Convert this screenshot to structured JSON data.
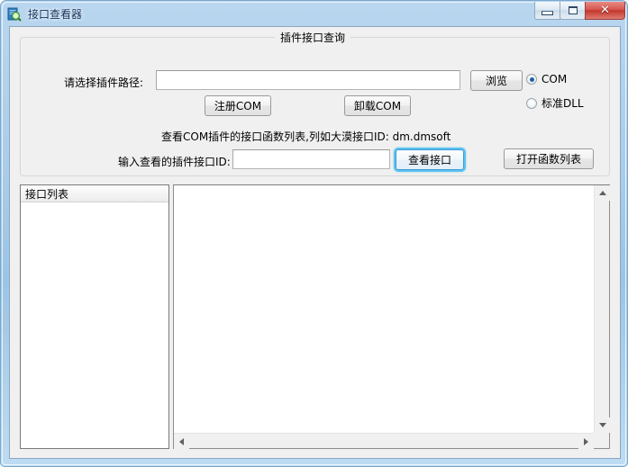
{
  "window": {
    "title": "接口查看器",
    "icon": "document-magnifier-icon",
    "controls": {
      "minimize": "minimize-icon",
      "maximize": "maximize-icon",
      "close": "✕"
    }
  },
  "group": {
    "title": "插件接口查询"
  },
  "form": {
    "path_label": "请选择插件路径:",
    "path_value": "",
    "path_placeholder": "",
    "browse_button": "浏览",
    "register_button": "注册COM",
    "unregister_button": "卸载COM",
    "hint_text": "查看COM插件的接口函数列表,列如大漠接口ID: dm.dmsoft",
    "id_label": "输入查看的插件接口ID:",
    "id_value": "",
    "id_placeholder": "",
    "view_button": "查看接口",
    "open_function_list_button": "打开函数列表"
  },
  "radios": {
    "options": [
      {
        "label": "COM",
        "checked": true
      },
      {
        "label": "标准DLL",
        "checked": false
      }
    ]
  },
  "list_panel": {
    "header": "接口列表",
    "rows": []
  },
  "output_panel": {
    "text": ""
  },
  "colors": {
    "frame": "#9cc4e4",
    "accent_focus": "#5bc3f0",
    "radio_dot": "#1c5fa8",
    "close_button": "#c2382f",
    "client_bg": "#f0f0f0"
  }
}
